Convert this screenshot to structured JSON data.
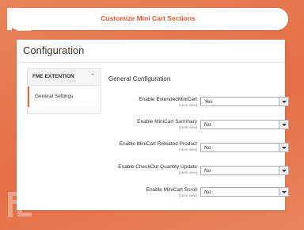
{
  "header": {
    "title": "Customize Mini Cart Sections"
  },
  "page": {
    "title": "Configuration"
  },
  "sidebar": {
    "section": "FME EXTENTION",
    "items": [
      {
        "label": "General Settings"
      }
    ]
  },
  "main": {
    "section_title": "General Configuration",
    "fields": [
      {
        "label": "Enable ExtendedMiniCart",
        "scope": "[store view]",
        "value": "Yes"
      },
      {
        "label": "Enable MiniCart Summary",
        "scope": "[store view]",
        "value": "No"
      },
      {
        "label": "Enable MiniCart Releated Product",
        "scope": "[store view]",
        "value": "No"
      },
      {
        "label": "Enable CheckOut Quantity Update",
        "scope": "[store view]",
        "value": "No"
      },
      {
        "label": "Enable MiniCart Scroll",
        "scope": "[store view]",
        "value": "No"
      }
    ]
  },
  "colors": {
    "accent": "#e56f46",
    "brand_text": "#e05a2e"
  },
  "icons": {
    "logo": "fme-logo-icon",
    "chevron": "chevron-up-icon",
    "select_arrow": "dropdown-arrow-icon"
  }
}
